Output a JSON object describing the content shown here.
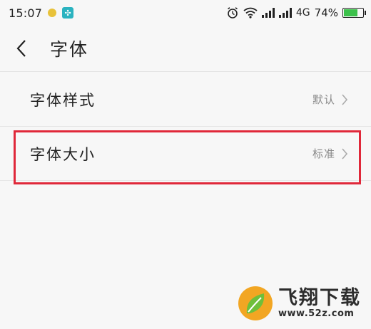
{
  "status_bar": {
    "time": "15:07",
    "network": "4G",
    "battery_percent": "74%",
    "battery_level": 0.74,
    "icons": [
      "coin-icon",
      "app-icon",
      "alarm-icon",
      "wifi-icon",
      "signal-icon",
      "signal-icon",
      "battery-icon"
    ]
  },
  "header": {
    "title": "字体"
  },
  "settings": {
    "rows": [
      {
        "label": "字体样式",
        "value": "默认"
      },
      {
        "label": "字体大小",
        "value": "标准"
      }
    ]
  },
  "watermark": {
    "title": "飞翔下载",
    "url": "www.52z.com"
  },
  "colors": {
    "highlight": "#e0283a",
    "battery": "#3cc14b",
    "background": "#f7f7f7"
  }
}
